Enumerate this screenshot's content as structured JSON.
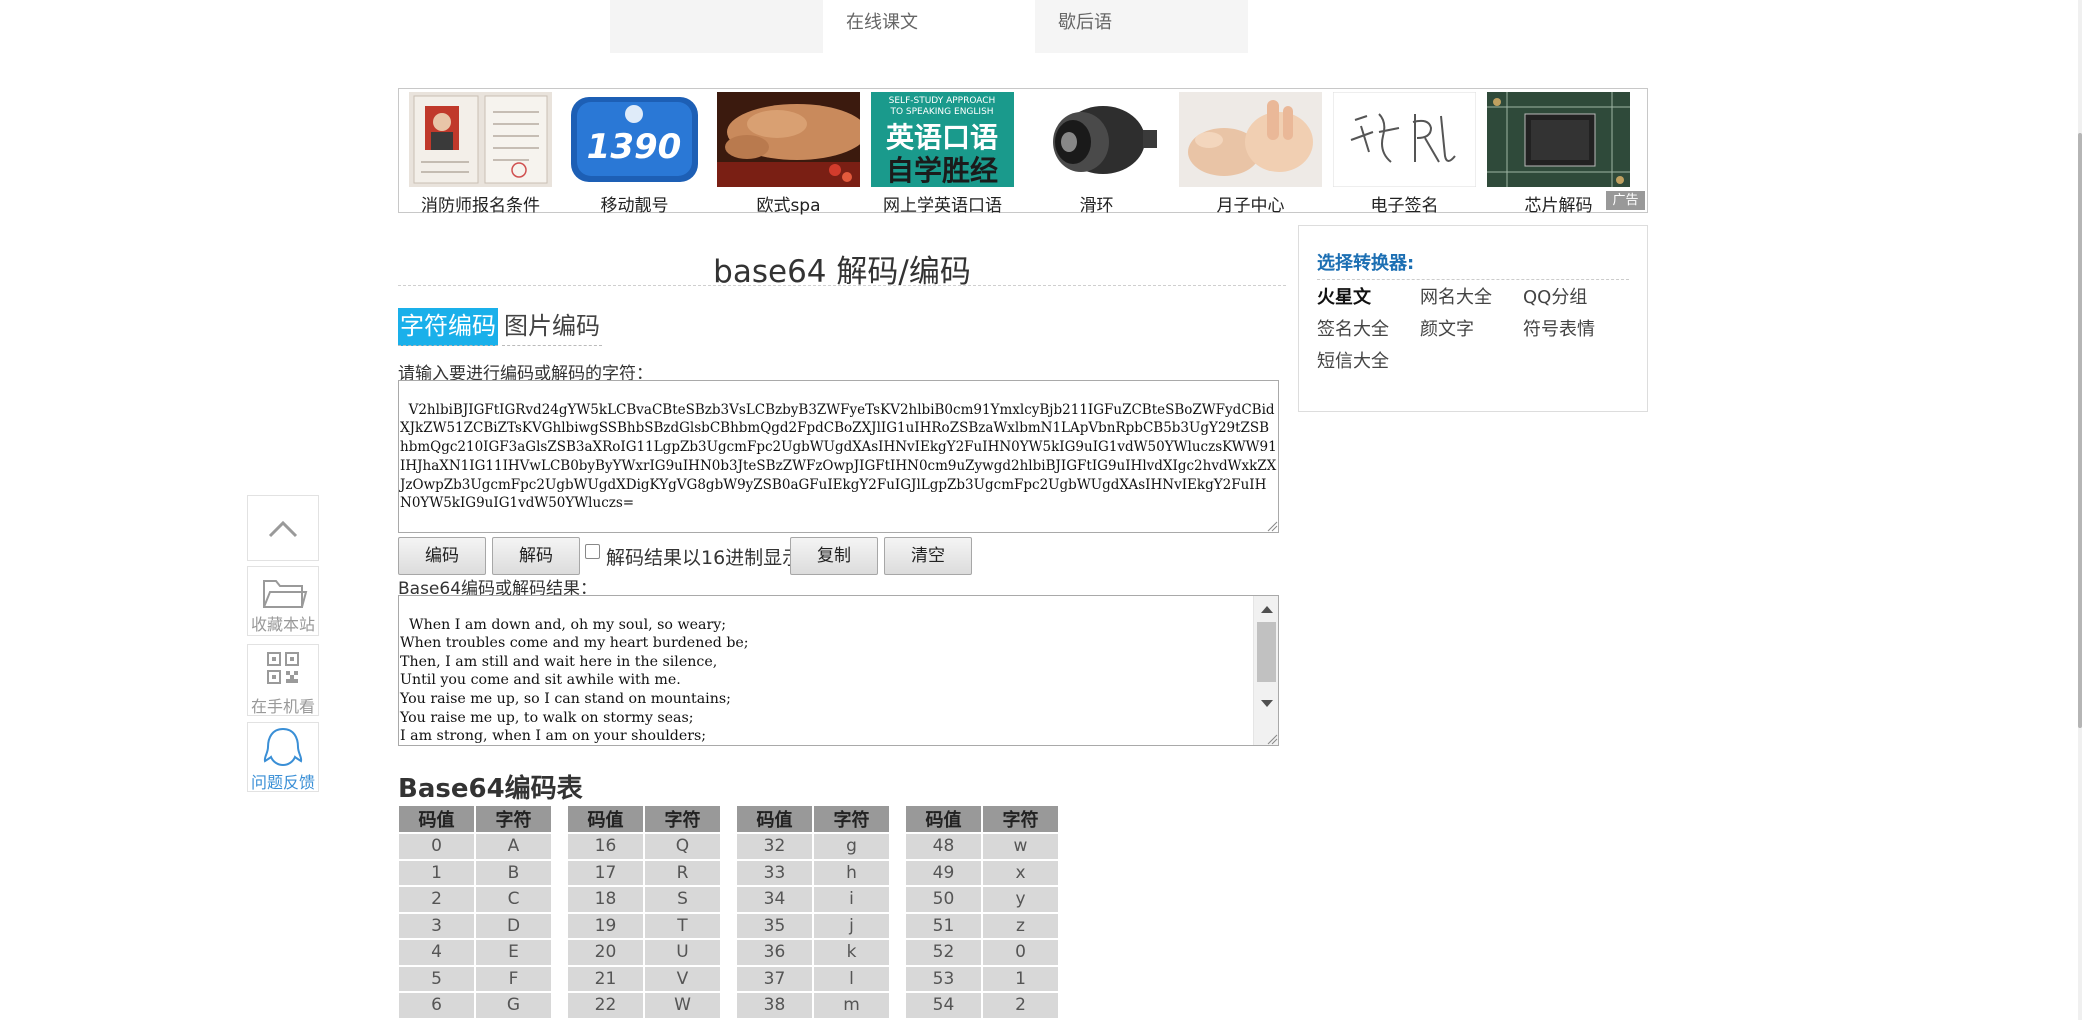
{
  "top_nav": {
    "items": [
      "在线课文",
      "歇后语"
    ]
  },
  "ads": {
    "items": [
      {
        "label": "消防师报名条件",
        "icon": "id-document-photo"
      },
      {
        "label": "移动靓号",
        "icon": "mobile-number-badge-1390"
      },
      {
        "label": "欧式spa",
        "icon": "spa-massage-photo"
      },
      {
        "label": "网上学英语口语",
        "icon": "english-book-cover",
        "cover_line1": "SELF-STUDY APPROACH",
        "cover_line2": "TO SPEAKING ENGLISH",
        "cover_big1": "英语口语",
        "cover_big2": "自学胜经"
      },
      {
        "label": "滑环",
        "icon": "slip-ring-photo"
      },
      {
        "label": "月子中心",
        "icon": "baby-hands-photo"
      },
      {
        "label": "电子签名",
        "icon": "handwritten-signature"
      },
      {
        "label": "芯片解码",
        "icon": "circuit-chip-photo"
      }
    ],
    "ad_badge": "广告",
    "badge_number": "1390"
  },
  "float_tools": {
    "favorite": "收藏本站",
    "mobile": "在手机看",
    "feedback": "问题反馈"
  },
  "main": {
    "title": "base64 解码/编码",
    "tabs": [
      "字符编码",
      "图片编码"
    ],
    "input_label": "请输入要进行编码或解码的字符：",
    "input_value": "V2hlbiBJIGFtIGRvd24gYW5kLCBvaCBteSBzb3VsLCBzbyB3ZWFyeTsKV2hlbiB0cm91YmxlcyBjb211IGFuZCBteSBoZWFydCBidXJkZW51ZCBiZTsKVGhlbiwgSSBhbSBzdGlsbCBhbmQgd2FpdCBoZXJlIG1uIHRoZSBzaWxlbmN1LApVbnRpbCB5b3UgY29tZSBhbmQgc210IGF3aGlsZSB3aXRoIG11LgpZb3UgcmFpc2UgbWUgdXAsIHNvIEkgY2FuIHN0YW5kIG9uIG1vdW50YWluczsKWW91IHJhaXN1IG11IHVwLCB0byByYWxrIG9uIHN0b3JteSBzZWFzOwpJIGFtIHN0cm9uZywgd2hlbiBJIGFtIG9uIHlvdXIgc2hvdWxkZXJzOwpZb3UgcmFpc2UgbWUgdXDigKYgVG8gbW9yZSB0aGFuIEkgY2FuIGJlLgpZb3UgcmFpc2UgbWUgdXAsIHNvIEkgY2FuIHN0YW5kIG9uIG1vdW50YWluczs=",
    "buttons": {
      "encode": "编码",
      "decode": "解码",
      "copy": "复制",
      "clear": "清空"
    },
    "hex_label": "解码结果以16进制显示",
    "output_label": "Base64编码或解码结果：",
    "output_value": "When I am down and, oh my soul, so weary;\nWhen troubles come and my heart burdened be;\nThen, I am still and wait here in the silence,\nUntil you come and sit awhile with me.\nYou raise me up, so I can stand on mountains;\nYou raise me up, to walk on stormy seas;\nI am strong, when I am on your shoulders;\nYou raise me up… To more than I can be."
  },
  "base64_table": {
    "title": "Base64编码表",
    "headers": [
      "码值",
      "字符"
    ],
    "groups": [
      {
        "rows": [
          [
            "0",
            "A"
          ],
          [
            "1",
            "B"
          ],
          [
            "2",
            "C"
          ],
          [
            "3",
            "D"
          ],
          [
            "4",
            "E"
          ],
          [
            "5",
            "F"
          ],
          [
            "6",
            "G"
          ]
        ]
      },
      {
        "rows": [
          [
            "16",
            "Q"
          ],
          [
            "17",
            "R"
          ],
          [
            "18",
            "S"
          ],
          [
            "19",
            "T"
          ],
          [
            "20",
            "U"
          ],
          [
            "21",
            "V"
          ],
          [
            "22",
            "W"
          ]
        ]
      },
      {
        "rows": [
          [
            "32",
            "g"
          ],
          [
            "33",
            "h"
          ],
          [
            "34",
            "i"
          ],
          [
            "35",
            "j"
          ],
          [
            "36",
            "k"
          ],
          [
            "37",
            "l"
          ],
          [
            "38",
            "m"
          ]
        ]
      },
      {
        "rows": [
          [
            "48",
            "w"
          ],
          [
            "49",
            "x"
          ],
          [
            "50",
            "y"
          ],
          [
            "51",
            "z"
          ],
          [
            "52",
            "0"
          ],
          [
            "53",
            "1"
          ],
          [
            "54",
            "2"
          ]
        ]
      }
    ]
  },
  "converter": {
    "title": "选择转换器:",
    "links": [
      "火星文",
      "网名大全",
      "QQ分组",
      "签名大全",
      "颜文字",
      "符号表情",
      "短信大全"
    ]
  },
  "colors": {
    "tab_active_bg": "#1ab0ea",
    "converter_title": "#1c6fb3",
    "feedback_blue": "#3a8fd6",
    "table_header": "#999999",
    "table_cell": "#d8d8d8"
  }
}
